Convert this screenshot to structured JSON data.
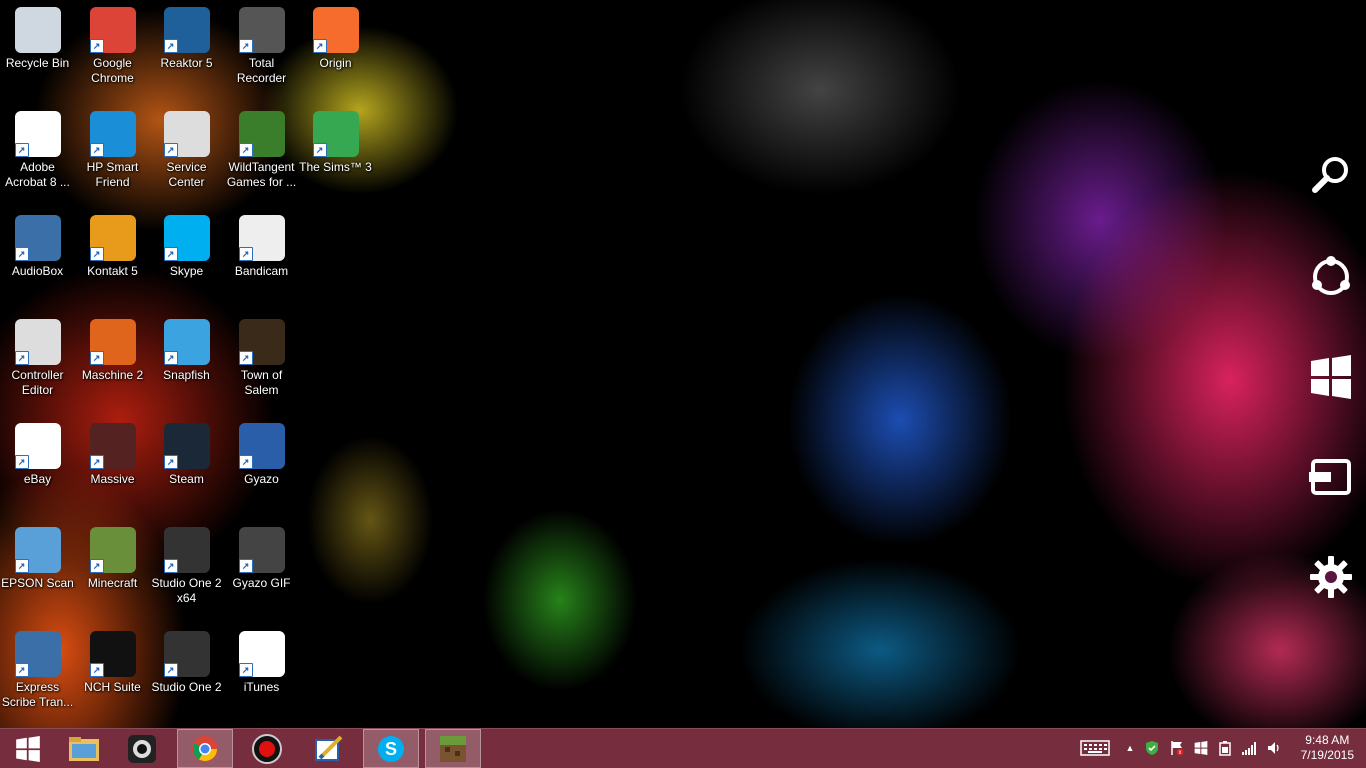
{
  "desktop": {
    "icons": [
      {
        "label": "Recycle Bin",
        "icon": "recycle-bin-icon",
        "color": "#cfd8e0"
      },
      {
        "label": "Google Chrome",
        "icon": "chrome-icon",
        "color": "#db4437"
      },
      {
        "label": "Reaktor 5",
        "icon": "reaktor-icon",
        "color": "#1f5f9a"
      },
      {
        "label": "Total Recorder",
        "icon": "speaker-icon",
        "color": "#555555"
      },
      {
        "label": "Origin",
        "icon": "origin-icon",
        "color": "#f56c2d"
      },
      {
        "label": "Adobe Acrobat 8 ...",
        "icon": "acrobat-icon",
        "color": "#ffffff"
      },
      {
        "label": "HP Smart Friend",
        "icon": "hp-icon",
        "color": "#1a8fd8"
      },
      {
        "label": "Service Center",
        "icon": "service-center-icon",
        "color": "#dddddd"
      },
      {
        "label": "WildTangent Games for ...",
        "icon": "wildtangent-icon",
        "color": "#3a7d2a"
      },
      {
        "label": "The Sims™ 3",
        "icon": "sims-icon",
        "color": "#36a852"
      },
      {
        "label": "AudioBox",
        "icon": "audiobox-icon",
        "color": "#3b6fa8"
      },
      {
        "label": "Kontakt 5",
        "icon": "kontakt-icon",
        "color": "#e89a1a"
      },
      {
        "label": "Skype",
        "icon": "skype-icon",
        "color": "#00aff0"
      },
      {
        "label": "Bandicam",
        "icon": "bandicam-icon",
        "color": "#eeeeee"
      },
      {
        "label": "Controller Editor",
        "icon": "controller-editor-icon",
        "color": "#dddddd"
      },
      {
        "label": "Maschine 2",
        "icon": "maschine-icon",
        "color": "#e0651c"
      },
      {
        "label": "Snapfish",
        "icon": "snapfish-icon",
        "color": "#3aa3e0"
      },
      {
        "label": "Town of Salem",
        "icon": "town-of-salem-icon",
        "color": "#3a2a1a"
      },
      {
        "label": "eBay",
        "icon": "ebay-icon",
        "color": "#ffffff"
      },
      {
        "label": "Massive",
        "icon": "massive-icon",
        "color": "#552222"
      },
      {
        "label": "Steam",
        "icon": "steam-icon",
        "color": "#1b2838"
      },
      {
        "label": "Gyazo",
        "icon": "gyazo-icon",
        "color": "#2a5ea8"
      },
      {
        "label": "EPSON Scan",
        "icon": "epson-scan-icon",
        "color": "#5aa0d8"
      },
      {
        "label": "Minecraft",
        "icon": "minecraft-icon",
        "color": "#6a8f3a"
      },
      {
        "label": "Studio One 2 x64",
        "icon": "studio-one-icon",
        "color": "#333333"
      },
      {
        "label": "Gyazo GIF",
        "icon": "gyazo-gif-icon",
        "color": "#444444"
      },
      {
        "label": "Express Scribe Tran...",
        "icon": "express-scribe-icon",
        "color": "#3a6fa8"
      },
      {
        "label": "NCH Suite",
        "icon": "nch-icon",
        "color": "#111111"
      },
      {
        "label": "Studio One 2",
        "icon": "studio-one-icon",
        "color": "#333333"
      },
      {
        "label": "iTunes",
        "icon": "itunes-icon",
        "color": "#ffffff"
      }
    ]
  },
  "charms": [
    {
      "name": "search-charm",
      "icon": "search-icon"
    },
    {
      "name": "share-charm",
      "icon": "share-icon"
    },
    {
      "name": "start-charm",
      "icon": "windows-logo-icon"
    },
    {
      "name": "devices-charm",
      "icon": "devices-icon"
    },
    {
      "name": "settings-charm",
      "icon": "gear-icon"
    }
  ],
  "taskbar": {
    "pinned": [
      {
        "name": "start-button",
        "icon": "windows-logo-icon"
      },
      {
        "name": "file-explorer",
        "icon": "folder-icon"
      },
      {
        "name": "taskbar-app-webcam",
        "icon": "webcam-icon"
      },
      {
        "name": "taskbar-chrome",
        "icon": "chrome-icon",
        "active": true
      },
      {
        "name": "taskbar-record",
        "icon": "record-icon"
      },
      {
        "name": "taskbar-gyazo",
        "icon": "gyazo-icon"
      },
      {
        "name": "taskbar-skype",
        "icon": "skype-icon"
      },
      {
        "name": "taskbar-minecraft",
        "icon": "minecraft-icon",
        "active": true
      }
    ],
    "tray": [
      {
        "name": "keyboard-icon"
      },
      {
        "name": "show-hidden-icons-icon",
        "glyph": "▲"
      },
      {
        "name": "security-shield-icon"
      },
      {
        "name": "action-center-flag-icon"
      },
      {
        "name": "windows-update-icon"
      },
      {
        "name": "battery-icon"
      },
      {
        "name": "network-signal-icon"
      },
      {
        "name": "volume-icon"
      }
    ],
    "clock": {
      "time": "9:48 AM",
      "date": "7/19/2015"
    }
  }
}
